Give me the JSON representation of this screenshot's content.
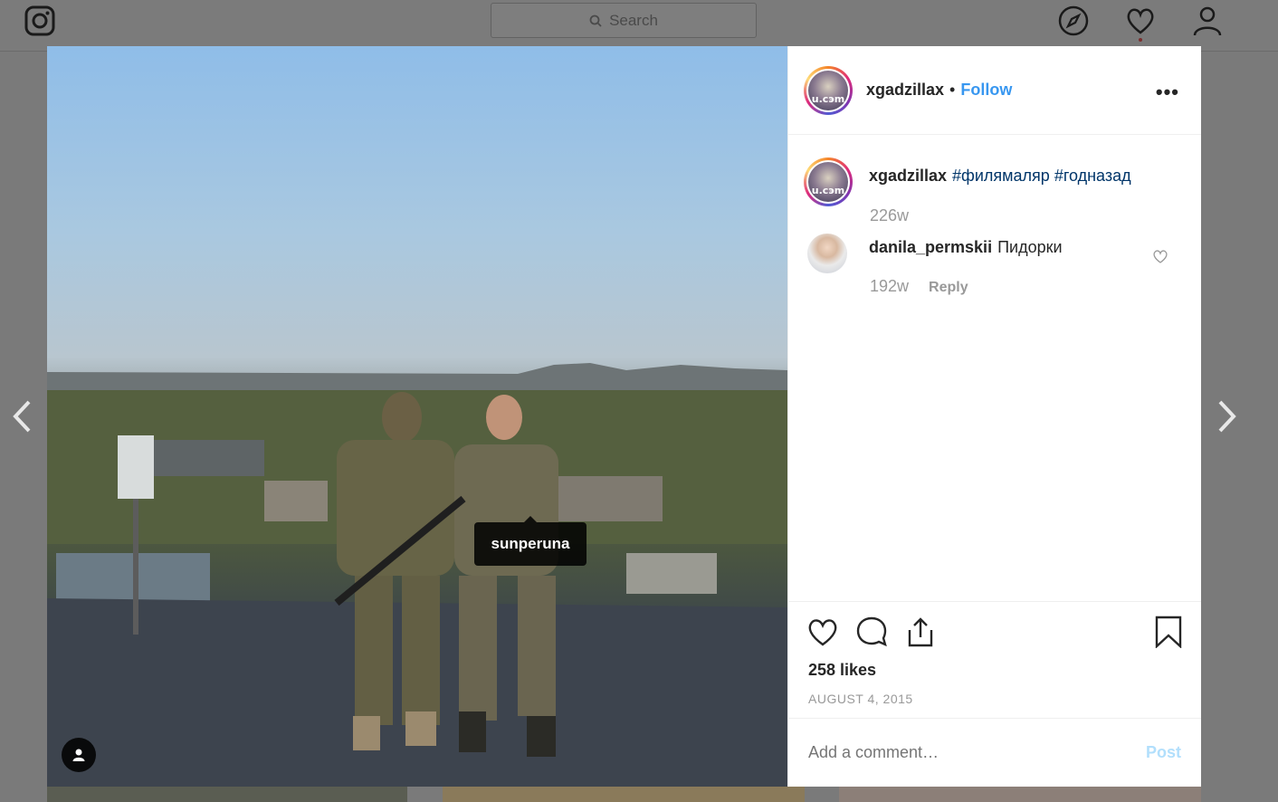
{
  "nav": {
    "search_placeholder": "Search"
  },
  "post": {
    "username": "xgadzillax",
    "follow_label": "Follow",
    "separator": "•",
    "more_label": "•••",
    "tag_label": "sunperuna",
    "avatar_text": "u.cэm"
  },
  "comments": [
    {
      "username": "xgadzillax",
      "text": "#филямаляр #годназад",
      "age": "226w"
    },
    {
      "username": "danila_permskii",
      "text": "Пидорки",
      "age": "192w",
      "reply_label": "Reply"
    }
  ],
  "footer": {
    "likes": "258 likes",
    "date": "AUGUST 4, 2015",
    "comment_placeholder": "Add a comment…",
    "post_label": "Post"
  }
}
